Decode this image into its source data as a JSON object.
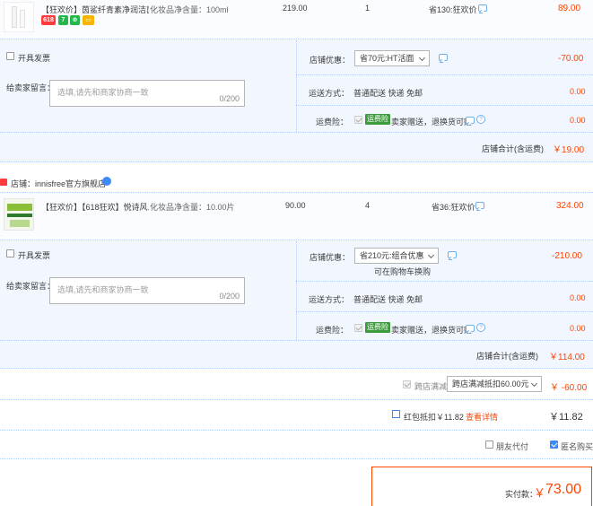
{
  "order1": {
    "title": "【狂欢价】茵鲨纤青素净润洁面...",
    "spec": "化妆品净含量：100ml",
    "price": "219.00",
    "qty": "1",
    "save": "省130:狂欢价",
    "total": "89.00",
    "invoice_label": "开具发票",
    "message_label": "给卖家留言：",
    "message_placeholder": "选填,请先和商家协商一致",
    "message_count": "0/200",
    "shop_discount_label": "店铺优惠：",
    "shop_discount_value": "省70元:HT活面",
    "shop_discount_amount": "-70.00",
    "shipping_label": "运送方式：",
    "shipping_value": "普通配送 快递 免邮",
    "shipping_amount": "0.00",
    "insurance_label": "运费险：",
    "insurance_tag": "运费险",
    "insurance_text": "卖家赠送，退换货可赔",
    "insurance_amount": "0.00",
    "subtotal_label": "店铺合计(含运费)",
    "subtotal_value": "￥19.00"
  },
  "order2": {
    "store_label": "店铺：innisfree官方旗舰店",
    "title": "【狂欢价】【618狂欢】悦诗风...",
    "spec": "化妆品净含量：10.00片",
    "price": "90.00",
    "qty": "4",
    "save": "省36:狂欢价",
    "total": "324.00",
    "invoice_label": "开具发票",
    "message_label": "给卖家留言：",
    "message_placeholder": "选填,请先和商家协商一致",
    "message_count": "0/200",
    "shop_discount_label": "店铺优惠：",
    "shop_discount_value": "省210元:组合优惠",
    "shop_discount_note": "可在购物车换购",
    "shop_discount_amount": "-210.00",
    "shipping_label": "运送方式：",
    "shipping_value": "普通配送 快递 免邮",
    "shipping_amount": "0.00",
    "insurance_label": "运费险：",
    "insurance_tag": "运费险",
    "insurance_text": "卖家赠送，退换货可赔",
    "insurance_amount": "0.00",
    "subtotal_label": "店铺合计(含运费)",
    "subtotal_value": "￥114.00"
  },
  "summary": {
    "cross_store_label": "跨店满减",
    "cross_store_value": "跨店满减抵扣60.00元",
    "cross_store_amount": "￥ -60.00",
    "redpack_label": "红包抵扣￥11.82",
    "redpack_link": "查看详情",
    "redpack_amount": "￥11.82",
    "friend_pay_label": "朋友代付",
    "anonymous_label": "匿名购买",
    "paid_label": "实付款：",
    "paid_currency": "￥",
    "paid_value": "73.00"
  },
  "badges": [
    "618",
    "7",
    "⊕",
    "▭"
  ],
  "colors": {
    "accent": "#f40",
    "blue": "#3d8af7",
    "panel": "#f2f7ff"
  }
}
